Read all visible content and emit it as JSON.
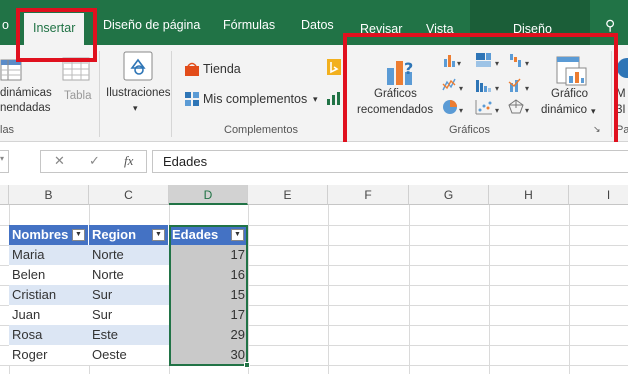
{
  "tabs": {
    "prev_partial": "o",
    "insertar": "Insertar",
    "diseno_pagina": "Diseño de página",
    "formulas": "Fórmulas",
    "datos": "Datos",
    "revisar": "Revisar",
    "vista": "Vista",
    "diseno": "Diseño"
  },
  "ribbon": {
    "tables": {
      "pivot_label_1": "dinámicas",
      "pivot_label_2": "nendadas",
      "table_label": "Tabla",
      "group_partial": "las"
    },
    "illustrations": {
      "label": "Ilustraciones"
    },
    "complementos": {
      "tienda": "Tienda",
      "mis_complementos": "Mis complementos",
      "group_label": "Complementos"
    },
    "graficos": {
      "recomendados_1": "Gráficos",
      "recomendados_2": "recomendados",
      "dinamico_1": "Gráfico",
      "dinamico_2": "dinámico",
      "group_label": "Gráficos"
    },
    "right_partial": {
      "line1": "M",
      "line2": "3I",
      "group": "Pas"
    }
  },
  "formula_bar": {
    "cancel": "✕",
    "enter": "✓",
    "fx": "fx",
    "content": "Edades"
  },
  "columns": [
    "B",
    "C",
    "D",
    "E",
    "F",
    "G",
    "H",
    "I"
  ],
  "table": {
    "headers": [
      "Nombres",
      "Region",
      "Edades"
    ],
    "rows": [
      [
        "Maria",
        "Norte",
        "17"
      ],
      [
        "Belen",
        "Norte",
        "16"
      ],
      [
        "Cristian",
        "Sur",
        "15"
      ],
      [
        "Juan",
        "Sur",
        "17"
      ],
      [
        "Rosa",
        "Este",
        "29"
      ],
      [
        "Roger",
        "Oeste",
        "30"
      ]
    ]
  },
  "colors": {
    "excel_green": "#217346",
    "table_header": "#4472c4",
    "band": "#dce6f4",
    "highlight": "#e0101e"
  }
}
